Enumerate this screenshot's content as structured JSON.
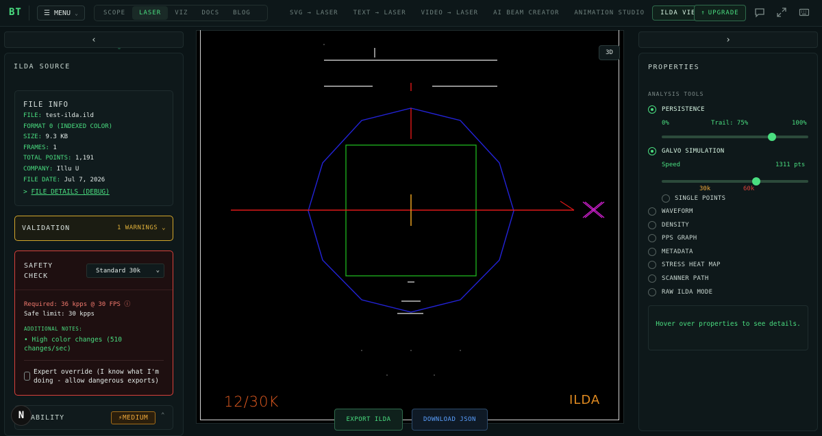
{
  "header": {
    "logo": "BT",
    "menu_label": "MENU",
    "tabs": [
      {
        "label": "SCOPE",
        "active": false
      },
      {
        "label": "LASER",
        "active": true
      },
      {
        "label": "VIZ",
        "active": false
      },
      {
        "label": "DOCS",
        "active": false
      },
      {
        "label": "BLOG",
        "active": false
      }
    ],
    "tools": [
      {
        "label": "SVG → LASER",
        "active": false
      },
      {
        "label": "TEXT → LASER",
        "active": false
      },
      {
        "label": "VIDEO → LASER",
        "active": false
      },
      {
        "label": "AI BEAM CREATOR",
        "active": false
      },
      {
        "label": "ANIMATION STUDIO",
        "active": false
      },
      {
        "label": "ILDA VIEWER",
        "active": true
      }
    ],
    "upgrade_label": "UPGRADE"
  },
  "left": {
    "collapse_glyph": "‹",
    "title": "ILDA SOURCE",
    "file_info": {
      "title": "FILE INFO",
      "rows": [
        {
          "key": "FILE:",
          "value": "test-ilda.ild"
        },
        {
          "key": "FORMAT 0 (INDEXED COLOR)",
          "value": ""
        },
        {
          "key": "SIZE:",
          "value": "9.3 KB"
        },
        {
          "key": "FRAMES:",
          "value": "1"
        },
        {
          "key": "TOTAL POINTS:",
          "value": "1,191"
        },
        {
          "key": "COMPANY:",
          "value": "Illu U"
        },
        {
          "key": "FILE DATE:",
          "value": "Jul 7, 2026"
        }
      ],
      "debug_prefix": ">",
      "debug_label": "FILE DETAILS (DEBUG)"
    },
    "validation": {
      "label": "VALIDATION",
      "warnings": "1 WARNINGS"
    },
    "safety": {
      "title": "SAFETY CHECK",
      "select_value": "Standard 30k",
      "required": "Required: 36 kpps @ 30 FPS",
      "safe_limit": "Safe limit: 30 kpps",
      "notes_label": "ADDITIONAL NOTES:",
      "note": "• High color changes (510 changes/sec)",
      "override": "Expert override (I know what I'm doing - allow dangerous exports)"
    },
    "ability": {
      "label": "ABILITY",
      "badge": "⚡MEDIUM"
    },
    "n_badge": "N"
  },
  "canvas": {
    "label_3d": "3D",
    "overlay_left": "12/30K",
    "overlay_right": "ILDA",
    "export_ilda": "EXPORT ILDA",
    "download_json": "DOWNLOAD JSON"
  },
  "right": {
    "collapse_glyph": "›",
    "title": "PROPERTIES",
    "analysis_label": "ANALYSIS TOOLS",
    "persistence": {
      "label": "PERSISTENCE",
      "min": "0%",
      "trail": "Trail: 75%",
      "max": "100%",
      "value_fraction": 0.75
    },
    "galvo": {
      "label": "GALVO SIMULATION",
      "speed_label": "Speed",
      "speed_value": "1311 pts",
      "marker_30k": "30k",
      "marker_60k": "60k",
      "single_points": "SINGLE POINTS"
    },
    "options": [
      {
        "label": "WAVEFORM"
      },
      {
        "label": "DENSITY"
      },
      {
        "label": "PPS GRAPH"
      },
      {
        "label": "METADATA"
      },
      {
        "label": "STRESS HEAT MAP"
      },
      {
        "label": "SCANNER PATH"
      },
      {
        "label": "RAW ILDA MODE"
      }
    ],
    "hover_hint": "Hover over properties to see details."
  },
  "colors": {
    "accent": "#4ade80",
    "warning": "#e0b13a",
    "danger": "#d9413b",
    "laser_blue": "#2323d8",
    "laser_green": "#1fb81f",
    "laser_red": "#e01818",
    "laser_magenta": "#d020d0",
    "overlay_orange": "#e05a20"
  }
}
